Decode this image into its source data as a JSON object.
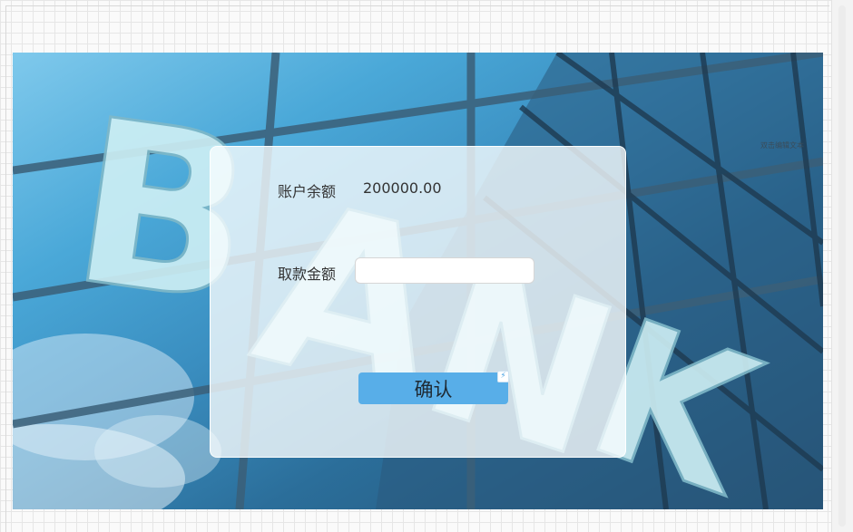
{
  "scene": {
    "sign_letters": [
      "B",
      "A",
      "N",
      "K"
    ],
    "corner_hint": "双击编辑文本"
  },
  "form": {
    "balance_label": "账户余额",
    "balance_value": "200000.00",
    "withdraw_label": "取款金额",
    "withdraw_value": "",
    "withdraw_placeholder": "",
    "confirm_label": "确认",
    "event_icon_glyph": "⚡"
  },
  "colors": {
    "button": "#58aee8",
    "sky": "#4aa8d8",
    "glass_dark": "#244f70"
  }
}
